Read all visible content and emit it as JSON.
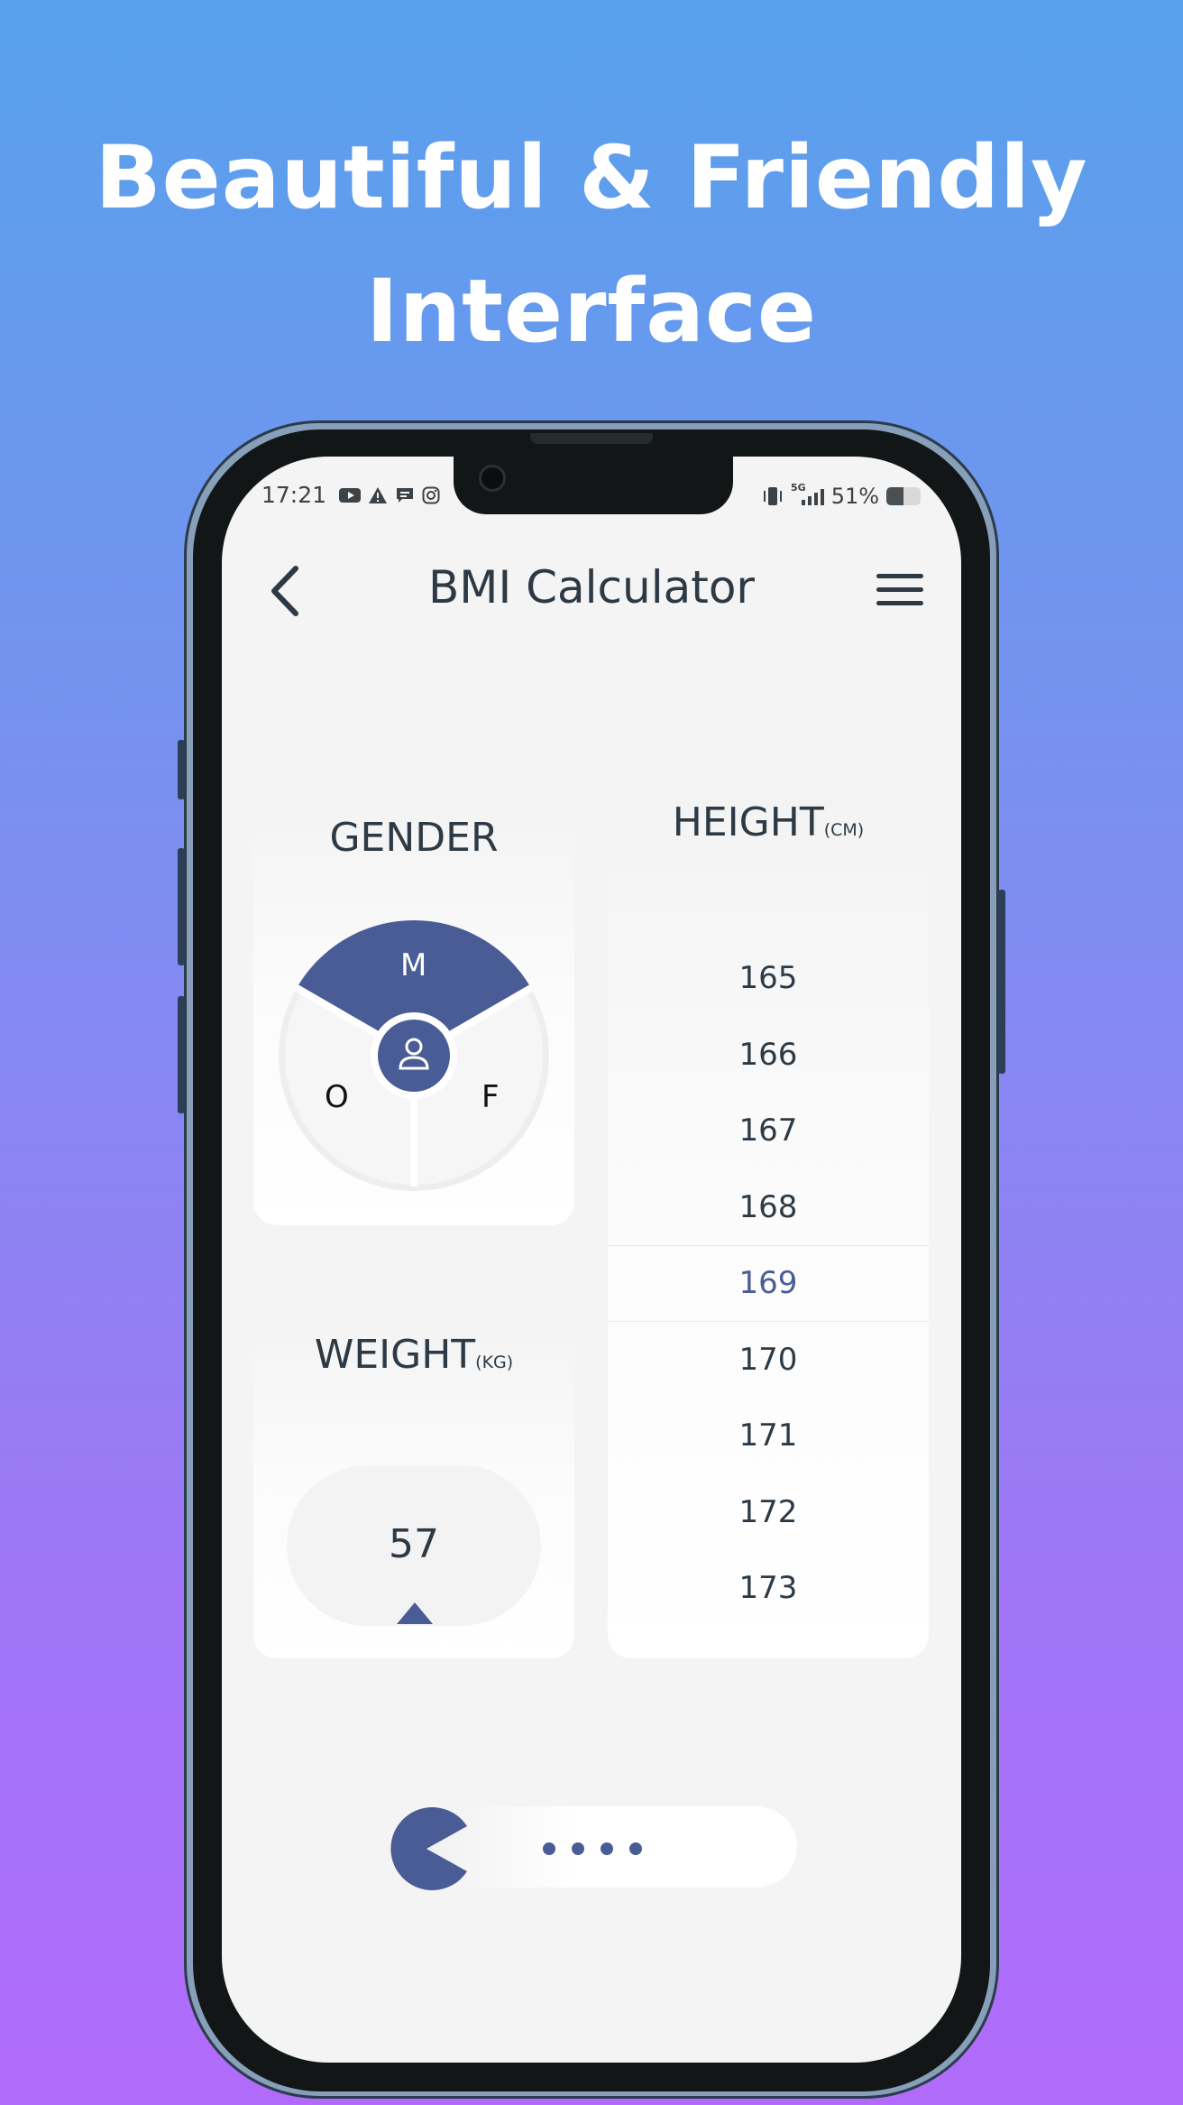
{
  "promo": {
    "line1": "Beautiful & Friendly",
    "line2": "Interface"
  },
  "status_bar": {
    "time": "17:21",
    "left_icons": [
      "youtube-icon",
      "warning-icon",
      "chat-icon",
      "instagram-icon"
    ],
    "network": "5G",
    "battery_percent": "51%",
    "battery_level": 0.51
  },
  "header": {
    "title": "BMI Calculator",
    "back_icon": "chevron-left-icon",
    "menu_icon": "hamburger-menu-icon"
  },
  "gender": {
    "title": "GENDER",
    "options": [
      "M",
      "F",
      "O"
    ],
    "selected": "M",
    "center_icon": "user-icon"
  },
  "weight": {
    "title": "WEIGHT",
    "unit": "(KG)",
    "value": "57"
  },
  "height": {
    "title": "HEIGHT",
    "unit": "(CM)",
    "values": [
      "165",
      "166",
      "167",
      "168",
      "169",
      "170",
      "171",
      "172",
      "173"
    ],
    "selected": "169"
  },
  "calculate_slider": {
    "handle_icon": "pacman-icon",
    "dots": 4
  },
  "colors": {
    "accent": "#4a5c95",
    "text": "#2d3a45",
    "screen_bg": "#f4f4f4"
  }
}
